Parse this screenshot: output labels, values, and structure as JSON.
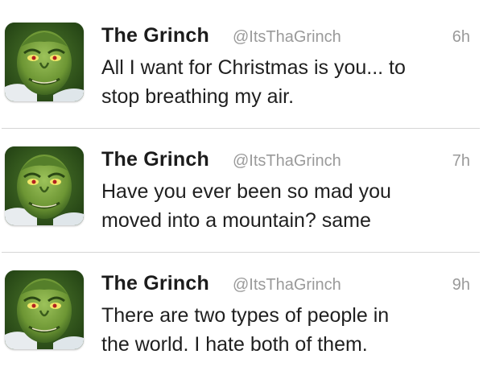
{
  "tweets": [
    {
      "name": "The Grinch",
      "handle": "@ItsThaGrinch",
      "time": "6h",
      "text_lines": [
        "All I want for Christmas is you... to",
        "stop breathing my air."
      ],
      "avatar_icon": "grinch-avatar"
    },
    {
      "name": "The Grinch",
      "handle": "@ItsThaGrinch",
      "time": "7h",
      "text_lines": [
        "Have you ever been so mad you",
        "moved into a mountain? same"
      ],
      "avatar_icon": "grinch-avatar"
    },
    {
      "name": "The Grinch",
      "handle": "@ItsThaGrinch",
      "time": "9h",
      "text_lines": [
        "There are two types of people in",
        "the world. I hate both of them."
      ],
      "avatar_icon": "grinch-avatar"
    }
  ],
  "colors": {
    "name": "#1c1c1c",
    "meta": "#9a9a9a",
    "text": "#1f1f1f",
    "divider": "#d6d6d6",
    "grinch_green": "#6f9a3a"
  }
}
